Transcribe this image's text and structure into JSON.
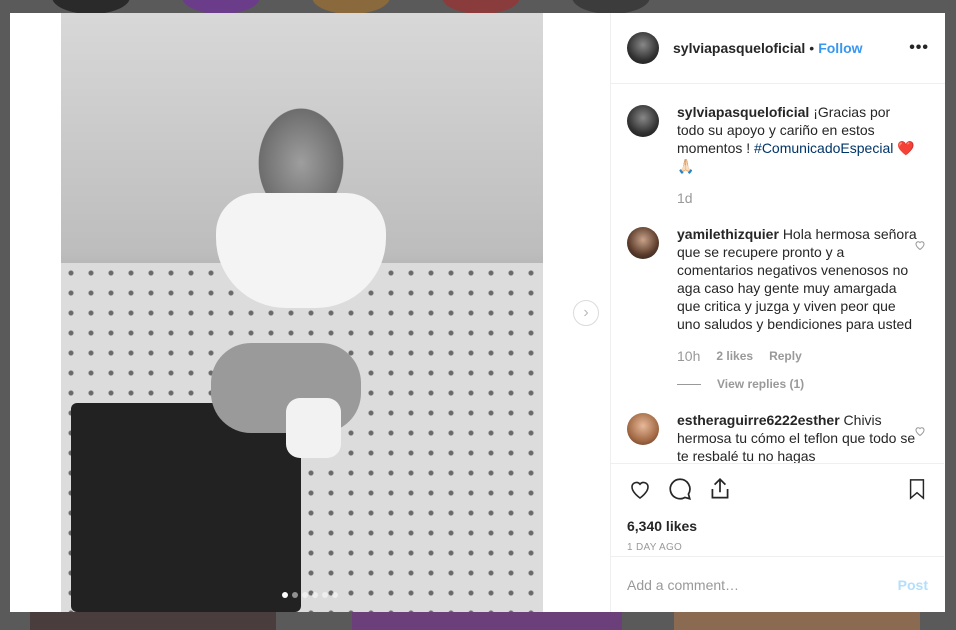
{
  "post": {
    "username": "sylviapasqueloficial",
    "follow_label": "Follow",
    "separator": "•",
    "more_label": "•••",
    "caption": "¡Gracias por todo su apoyo y cariño en estos momentos !",
    "hashtag": "#ComunicadoEspecial",
    "caption_emoji": "❤️🙏🏻",
    "caption_time": "1d",
    "likes": "6,340 likes",
    "time_ago": "1 DAY AGO",
    "carousel_count": 6,
    "carousel_active": 1
  },
  "comments": [
    {
      "username": "yamilethizquier",
      "text": "Hola hermosa señora que se recupere pronto y a comentarios negativos venenosos no aga caso hay gente muy amargada que critica y juzga y viven peor que uno saludos y bendiciones para usted",
      "time": "10h",
      "likes": "2 likes",
      "reply": "Reply",
      "view_replies": "View replies (1)"
    },
    {
      "username": "estheraguirre6222esther",
      "text": "Chivis hermosa tu cómo el teflon que todo se te resbalé tu no hagas"
    }
  ],
  "composer": {
    "placeholder": "Add a comment…",
    "post_label": "Post"
  },
  "icons": [
    "heart-icon",
    "comment-icon",
    "share-icon",
    "bookmark-icon",
    "chevron-right-icon"
  ],
  "colors": {
    "accent": "#3897f0",
    "hashtag": "#003569",
    "post_disabled": "#b2dffc"
  }
}
